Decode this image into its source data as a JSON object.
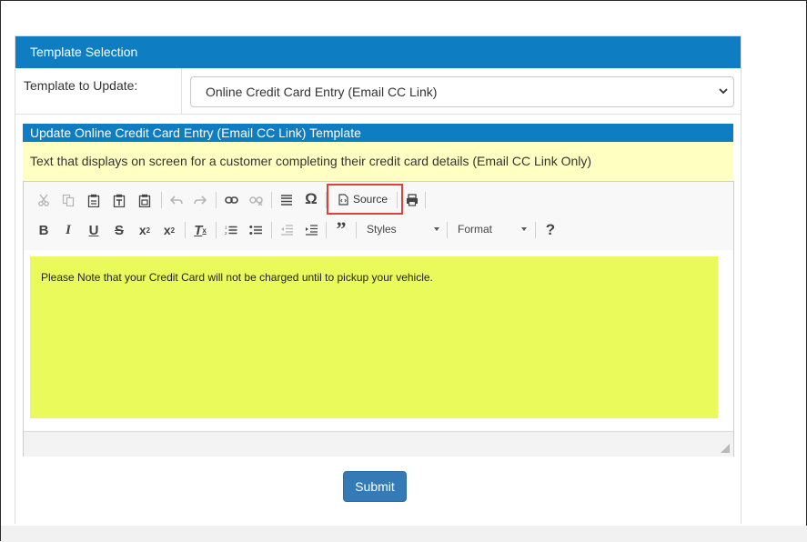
{
  "panel": {
    "title": "Template Selection"
  },
  "form": {
    "template_label": "Template to Update:",
    "template_selected": "Online Credit Card Entry (Email CC Link)"
  },
  "section": {
    "title": "Update Online Credit Card Entry (Email CC Link) Template",
    "description": "Text that displays on screen for a customer completing their credit card details (Email CC Link Only)"
  },
  "toolbar": {
    "row1": [
      "cut-icon",
      "copy-icon",
      "paste-icon",
      "paste-text-icon",
      "paste-word-icon",
      "undo-icon",
      "redo-icon",
      "link-icon",
      "unlink-icon",
      "horizontal-rule-icon",
      "special-char-icon",
      "source-code-icon",
      "print-icon"
    ],
    "source_label": "Source",
    "styles_label": "Styles",
    "format_label": "Format"
  },
  "editor": {
    "content": "Please Note that your Credit Card will not be charged until to pickup your vehicle."
  },
  "actions": {
    "submit_label": "Submit"
  },
  "colors": {
    "header_blue": "#0f7dc2",
    "note_yellow": "#ffffc1",
    "content_yellow": "#eafa5b",
    "submit_blue": "#337ab7",
    "highlight_red": "#e0403a"
  }
}
